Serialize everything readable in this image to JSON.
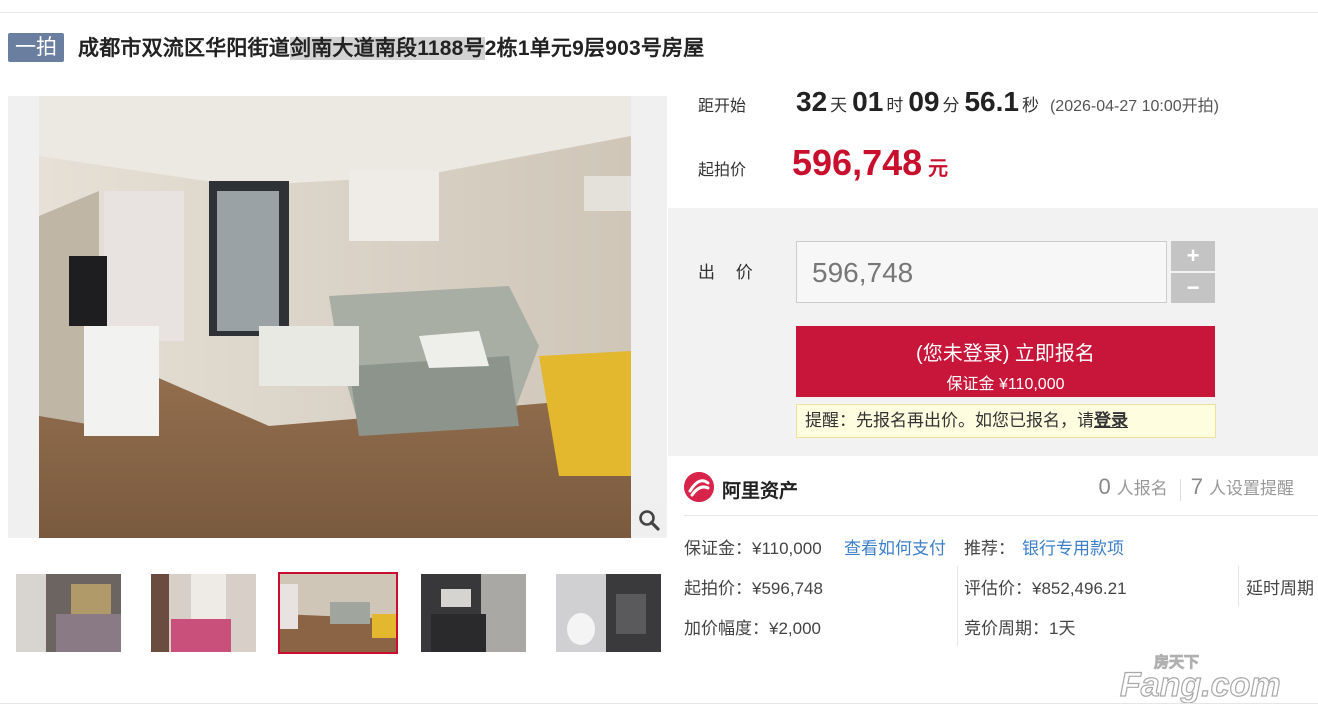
{
  "title": {
    "tag": "一拍",
    "prefix": "成都市双流区华阳街道",
    "highlight": "剑南大道南段1188号",
    "suffix": "2栋1单元9层903号房屋"
  },
  "countdown": {
    "label": "距开始",
    "days": "32",
    "days_unit": "天",
    "hours": "01",
    "hours_unit": "时",
    "minutes": "09",
    "minutes_unit": "分",
    "seconds": "56.1",
    "seconds_unit": "秒",
    "start_note": "(2026-04-27 10:00开拍)"
  },
  "start_price": {
    "label": "起拍价",
    "value": "596,748",
    "unit": "元"
  },
  "bid": {
    "label": "出 价",
    "value": "596,748",
    "plus": "+",
    "minus": "−",
    "signup_line1": "(您未登录) 立即报名",
    "signup_line2": "保证金 ¥110,000",
    "tip_text": "提醒：先报名再出价。如您已报名，请",
    "tip_link": "登录"
  },
  "brand": {
    "name": "阿里资产",
    "signups_count": "0",
    "signups_label": "人报名",
    "reminders_count": "7",
    "reminders_label": "人设置提醒"
  },
  "details": {
    "deposit": "保证金：¥110,000",
    "how_to_pay": "查看如何支付",
    "recommend_label": "推荐：",
    "recommend_link": "银行专用款项",
    "start_price": "起拍价：¥596,748",
    "appraisal": "评估价：¥852,496.21",
    "delay": "延时周期",
    "increment": "加价幅度：¥2,000",
    "cycle": "竞价周期：1天"
  },
  "watermark": {
    "top": "房天下",
    "main": "Fang.com"
  },
  "colors": {
    "accent": "#c8102e",
    "tag_bg": "#6a7fa0",
    "link": "#3d7fc8"
  },
  "icons": [
    "zoom-icon",
    "alibaba-asset-logo-icon"
  ]
}
